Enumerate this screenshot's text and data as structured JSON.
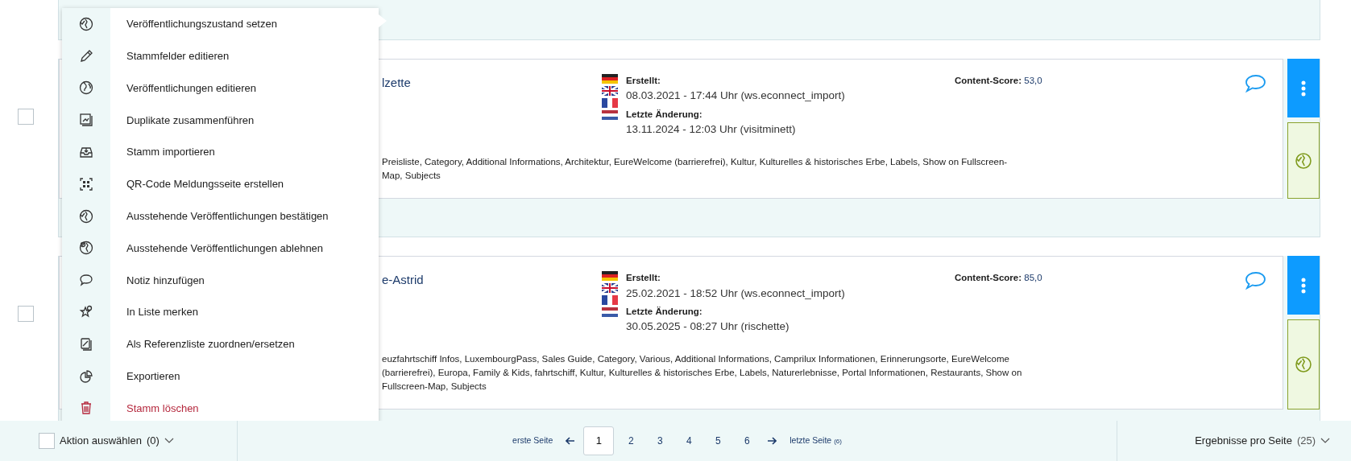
{
  "rows": [
    {
      "checked": false,
      "title": "lzette",
      "created_label": "Erstellt:",
      "created": "08.03.2021 - 17:44 Uhr (ws.econnect_import)",
      "changed_label": "Letzte Änderung:",
      "changed": "13.11.2024 - 12:03 Uhr (visitminett)",
      "score_label": "Content-Score:",
      "score": "53,0",
      "tags": "Preisliste, Category, Additional Informations, Architektur, EureWelcome (barrierefrei), Kultur, Kulturelles & historisches Erbe, Labels, Show on Fullscreen-Map, Subjects"
    },
    {
      "checked": false,
      "title": "e-Astrid",
      "created_label": "Erstellt:",
      "created": "25.02.2021 - 18:52 Uhr (ws.econnect_import)",
      "changed_label": "Letzte Änderung:",
      "changed": "30.05.2025 - 08:27 Uhr (rischette)",
      "score_label": "Content-Score:",
      "score": "85,0",
      "tags": "euzfahrtschiff Infos, LuxembourgPass, Sales Guide, Category, Various, Additional Informations, Camprilux Informationen, Erinnerungsorte, EureWelcome (barrierefrei), Europa, Family & Kids, fahrtschiff, Kultur, Kulturelles & historisches Erbe, Labels, Naturerlebnisse, Portal Informationen, Restaurants, Show on Fullscreen-Map, Subjects"
    }
  ],
  "menu": {
    "items": [
      {
        "label": "Veröffentlichungszustand setzen",
        "kind": "action"
      },
      {
        "label": "Stammfelder editieren",
        "kind": "action"
      },
      {
        "label": "Veröffentlichungen editieren",
        "kind": "action"
      },
      {
        "label": "Duplikate zusammenführen",
        "kind": "action"
      },
      {
        "label": "Stamm importieren",
        "kind": "action"
      },
      {
        "label": "QR-Code Meldungsseite erstellen",
        "kind": "action"
      },
      {
        "label": "Ausstehende Veröffentlichungen bestätigen",
        "kind": "action"
      },
      {
        "label": "Ausstehende Veröffentlichungen ablehnen",
        "kind": "action"
      },
      {
        "label": "Notiz hinzufügen",
        "kind": "action"
      },
      {
        "label": "In Liste merken",
        "kind": "action"
      },
      {
        "label": "Als Referenzliste zuordnen/ersetzen",
        "kind": "action"
      },
      {
        "label": "Exportieren",
        "kind": "action"
      },
      {
        "label": "Stamm löschen",
        "kind": "danger"
      }
    ]
  },
  "footer": {
    "action_select": {
      "checked": false,
      "label": "Aktion auswählen",
      "count": "(0)"
    },
    "pagination": {
      "first": "erste Seite",
      "last": "letzte Seite",
      "last_count": "(6)",
      "pages": [
        {
          "label": "1",
          "selected": true
        },
        {
          "label": "2",
          "selected": false
        },
        {
          "label": "3",
          "selected": false
        },
        {
          "label": "4",
          "selected": false
        },
        {
          "label": "5",
          "selected": false
        },
        {
          "label": "6",
          "selected": false
        }
      ]
    },
    "per_page": {
      "label": "Ergebnisse pro Seite",
      "count": "(25)"
    }
  }
}
